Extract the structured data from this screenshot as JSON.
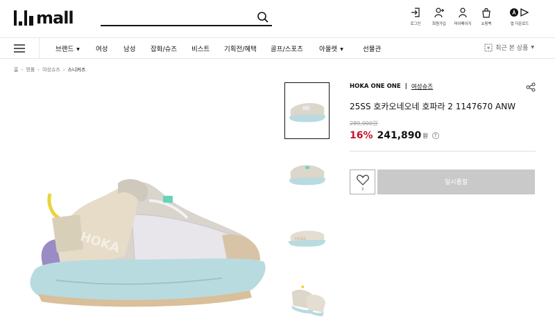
{
  "header": {
    "logo_text": "mall",
    "search_placeholder": "",
    "utils": [
      {
        "label": "로그인",
        "icon": "login-icon"
      },
      {
        "label": "회원가입",
        "icon": "signup-icon"
      },
      {
        "label": "마이페이지",
        "icon": "mypage-icon"
      },
      {
        "label": "쇼핑백",
        "icon": "shopping-bag-icon"
      },
      {
        "label": "앱 다운로드",
        "icon": "app-download-icon"
      }
    ]
  },
  "nav": {
    "items": [
      "브랜드",
      "여성",
      "남성",
      "잡화/슈즈",
      "비스트",
      "기획전/혜택",
      "골프/스포츠",
      "아울렛",
      "선물관"
    ],
    "recent_label": "최근 본 상품"
  },
  "breadcrumb": [
    "홈",
    "명품",
    "여성슈즈",
    "스니커즈"
  ],
  "product": {
    "brand": "HOKA ONE ONE",
    "category": "여성슈즈",
    "title": "25SS 호카오네오네 호파라 2 1147670 ANW",
    "original_price": "289,000원",
    "discount": "16%",
    "price": "241,890",
    "currency": "원",
    "help_mark": "?"
  },
  "actions": {
    "wish_count": "3",
    "soldout_label": "일시품절"
  },
  "colors": {
    "accent_red": "#c8102e",
    "soldout_gray": "#c9c9c9"
  }
}
